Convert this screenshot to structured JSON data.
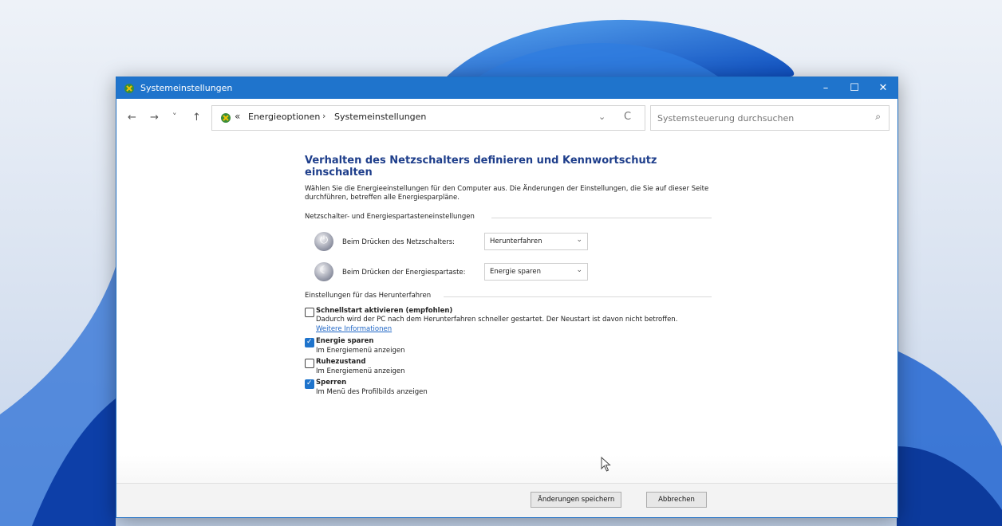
{
  "window": {
    "title": "Systemeinstellungen",
    "controls": {
      "minimize": "–",
      "maximize": "☐",
      "close": "✕"
    }
  },
  "nav": {
    "back": "←",
    "forward": "→",
    "recent": "˅",
    "up": "↑"
  },
  "address": {
    "prefix": "«",
    "crumbs": [
      "Energieoptionen",
      "Systemeinstellungen"
    ],
    "separator": "›",
    "dropdown": "⌄",
    "refresh": "C"
  },
  "search": {
    "placeholder": "Systemsteuerung durchsuchen",
    "icon": "search-icon",
    "glyph": "⌕"
  },
  "page": {
    "heading": "Verhalten des Netzschalters definieren und Kennwortschutz einschalten",
    "intro": "Wählen Sie die Energieeinstellungen für den Computer aus. Die Änderungen der Einstellungen, die Sie auf dieser Seite durchführen, betreffen alle Energiesparpläne.",
    "power_group_title": "Netzschalter- und Energiespartasteneinstellungen",
    "power_button": {
      "label": "Beim Drücken des Netzschalters:",
      "value": "Herunterfahren",
      "icon": "power-icon",
      "glyph": "⏻"
    },
    "sleep_button": {
      "label": "Beim Drücken der Energiespartaste:",
      "value": "Energie sparen",
      "icon": "sleep-icon",
      "glyph": "☾"
    },
    "shutdown_group_title": "Einstellungen für das Herunterfahren",
    "options": [
      {
        "title": "Schnellstart aktivieren (empfohlen)",
        "checked": false,
        "desc": "Dadurch wird der PC nach dem Herunterfahren schneller gestartet. Der Neustart ist davon nicht betroffen.",
        "link": "Weitere Informationen"
      },
      {
        "title": "Energie sparen",
        "checked": true,
        "desc": "Im Energiemenü anzeigen"
      },
      {
        "title": "Ruhezustand",
        "checked": false,
        "desc": "Im Energiemenü anzeigen"
      },
      {
        "title": "Sperren",
        "checked": true,
        "desc": "Im Menü des Profilbilds anzeigen"
      }
    ]
  },
  "footer": {
    "save": "Änderungen speichern",
    "cancel": "Abbrechen"
  },
  "colors": {
    "accent": "#1f74cc",
    "heading": "#1e3e8b",
    "link": "#1f66c5"
  }
}
